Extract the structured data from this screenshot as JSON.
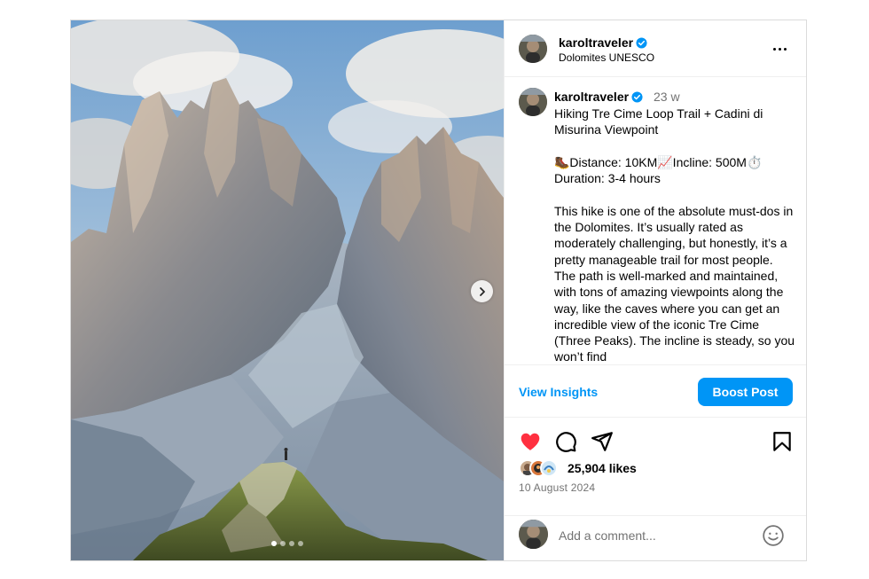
{
  "post": {
    "username": "karoltraveler",
    "verified": true,
    "location": "Dolomites UNESCO",
    "time_ago": "23 w",
    "caption": {
      "title": "Hiking Tre Cime Loop Trail + Cadini di Misurina Viewpoint",
      "stats": "🥾Distance: 10KM📈Incline: 500M⏱️ Duration: 3-4 hours",
      "body": "This hike is one of the absolute must-dos in the Dolomites. It’s usually rated as moderately challenging, but honestly, it’s a pretty manageable trail for most people. The path is well-marked and maintained, with tons of amazing viewpoints along the way, like the caves where you can get an incredible view of the iconic Tre Cime (Three Peaks). The incline is steady, so you won’t find"
    },
    "insights": {
      "view_label": "View Insights",
      "boost_label": "Boost Post"
    },
    "likes": "25,904 likes",
    "date": "10 August 2024",
    "comment": {
      "placeholder": "Add a comment..."
    },
    "carousel": {
      "slide_count": 4,
      "active_index": 0
    }
  },
  "icons": {
    "verified": "verified-badge-icon",
    "more": "more-options-icon",
    "like": "heart-filled-icon",
    "comment": "comment-bubble-icon",
    "share": "paper-plane-icon",
    "save": "bookmark-icon",
    "emoji": "smiley-icon",
    "next": "chevron-right-icon"
  },
  "colors": {
    "accent": "#0095f6",
    "like": "#ff3040",
    "muted": "#737373",
    "border": "#dbdbdb"
  }
}
